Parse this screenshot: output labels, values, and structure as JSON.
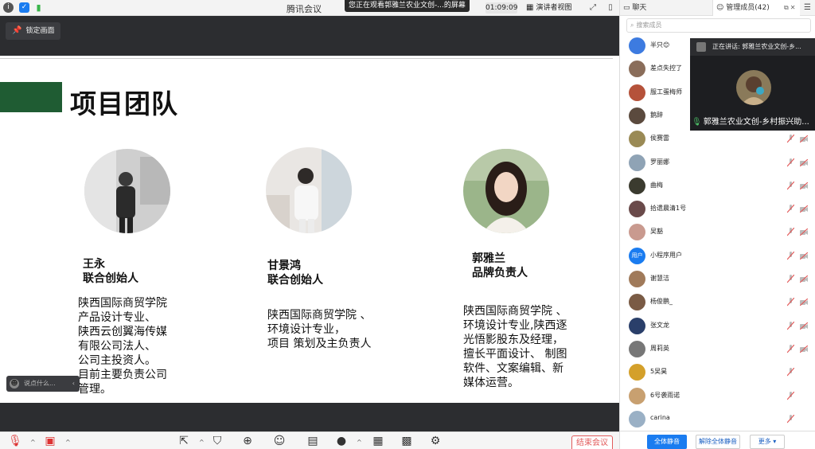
{
  "titlebar": {
    "title": "腾讯会议",
    "watching": "您正在观看郭雅兰农业文创-...的屏幕",
    "timer": "01:09:09",
    "view_label": "演讲者视图"
  },
  "stage": {
    "lock_label": "锁定画面",
    "chat_placeholder": "说点什么..."
  },
  "slide": {
    "title": "项目团队",
    "people": [
      {
        "name": "王永",
        "role": "联合创始人",
        "desc": "陕西国际商贸学院\n产品设计专业、\n陕西云创翼海传媒\n有限公司法人、\n公司主投资人。\n目前主要负责公司\n管理。"
      },
      {
        "name": "甘景鸿",
        "role": "联合创始人",
        "desc": "陕西国际商贸学院 、\n环境设计专业，\n项目 策划及主负责人"
      },
      {
        "name": "郭雅兰",
        "role": "品牌负责人",
        "desc": "陕西国际商贸学院 、\n环境设计专业,陕西逐\n光悟影股东及经理，\n擅长平面设计、 制图\n软件、文案编辑、新\n媒体运营。"
      }
    ]
  },
  "toolbar": {
    "end_label": "结束会议"
  },
  "panel": {
    "tab_chat": "聊天",
    "tab_members": "管理成员(42)",
    "search_placeholder": "搜索成员",
    "members": [
      {
        "name": "半只😊",
        "avatar_color": "#3d7be0"
      },
      {
        "name": "差点失控了",
        "avatar_color": "#8a6d5a"
      },
      {
        "name": "服工蛋梅师",
        "avatar_color": "#b5523a"
      },
      {
        "name": "鹅辞",
        "avatar_color": "#5b4a3e"
      },
      {
        "name": "侯赛雷",
        "avatar_color": "#9a8a55"
      },
      {
        "name": "罗丽娜",
        "avatar_color": "#8fa3b5"
      },
      {
        "name": "曲梅",
        "avatar_color": "#3b3b2f"
      },
      {
        "name": "拾遗晨清1号",
        "avatar_color": "#6a4a4a"
      },
      {
        "name": "吴豁",
        "avatar_color": "#c99a8f"
      },
      {
        "name": "小程序用户",
        "avatar_color": "#1a7cf0",
        "avatar_text": "用户"
      },
      {
        "name": "谢慧洁",
        "avatar_color": "#a07a5a"
      },
      {
        "name": "杨俊鹏_",
        "avatar_color": "#7a5b45"
      },
      {
        "name": "张文龙",
        "avatar_color": "#2a3f6a"
      },
      {
        "name": "周莉英",
        "avatar_color": "#777777"
      },
      {
        "name": "5吴昊",
        "avatar_color": "#d4a02a"
      },
      {
        "name": "6号袭雨诺",
        "avatar_color": "#c8a070"
      },
      {
        "name": "carina",
        "avatar_color": "#9ab0c5"
      }
    ],
    "mute_all": "全体静音",
    "unmute_all": "解除全体静音",
    "more": "更多 ▾"
  },
  "video": {
    "speaking": "正在讲话: 郭雅兰农业文创-乡...",
    "name": "郭雅兰农业文创-乡村振兴助..."
  }
}
